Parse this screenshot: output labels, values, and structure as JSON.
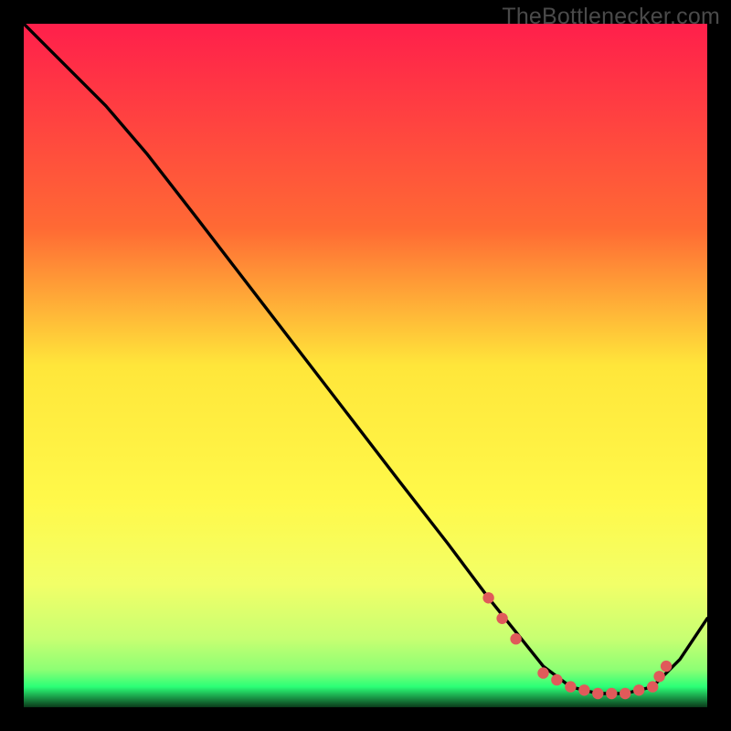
{
  "watermark": "TheBottlenecker.com",
  "colors": {
    "bg": "#000000",
    "grad_top": "#ff1f4b",
    "grad_mid_upper": "#ff8a2a",
    "grad_mid": "#ffe63a",
    "grad_lower": "#f7ff6a",
    "grad_green_light": "#b8ff7a",
    "grad_green": "#2bff77",
    "curve": "#000000",
    "dot": "#e05a5a"
  },
  "chart_data": {
    "type": "line",
    "title": "",
    "xlabel": "",
    "ylabel": "",
    "xlim": [
      0,
      100
    ],
    "ylim": [
      0,
      100
    ],
    "series": [
      {
        "name": "bottleneck-curve",
        "x": [
          0,
          4,
          8,
          12,
          18,
          25,
          35,
          45,
          55,
          62,
          68,
          72,
          76,
          80,
          84,
          88,
          92,
          96,
          100
        ],
        "y": [
          100,
          96,
          92,
          88,
          81,
          72,
          59,
          46,
          33,
          24,
          16,
          11,
          6,
          3,
          2,
          2,
          3,
          7,
          13
        ]
      }
    ],
    "dots": {
      "name": "highlight-dots",
      "x": [
        68,
        70,
        72,
        76,
        78,
        80,
        82,
        84,
        86,
        88,
        90,
        92,
        93,
        94
      ],
      "y": [
        16,
        13,
        10,
        5,
        4,
        3,
        2.5,
        2,
        2,
        2,
        2.5,
        3,
        4.5,
        6
      ]
    }
  }
}
